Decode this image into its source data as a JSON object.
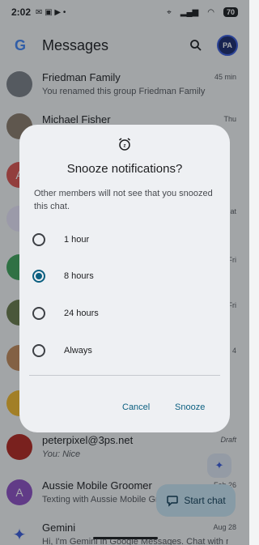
{
  "status_bar": {
    "time": "2:02",
    "battery": "70"
  },
  "app_bar": {
    "logo_letter": "G",
    "title": "Messages",
    "avatar_initials": "PA"
  },
  "conversations": [
    {
      "name": "Friedman Family",
      "snippet": "You renamed this group Friedman Family",
      "time": "45 min",
      "avatar_color": "#7b7f86",
      "avatar_text": ""
    },
    {
      "name": "Michael Fisher",
      "snippet": "",
      "time": "Thu",
      "avatar_color": "#8a7a6a",
      "avatar_text": ""
    },
    {
      "name": "",
      "snippet": "",
      "time": "",
      "avatar_color": "#d9534f",
      "avatar_text": "A"
    },
    {
      "name": "",
      "snippet": "",
      "time": "Sat",
      "avatar_color": "#e8e3f7",
      "avatar_text": ""
    },
    {
      "name": "",
      "snippet": "",
      "time": "Fri",
      "avatar_color": "#3fa35a",
      "avatar_text": ""
    },
    {
      "name": "",
      "snippet": "",
      "time": "Fri",
      "avatar_color": "#6a7a4a",
      "avatar_text": ""
    },
    {
      "name": "",
      "snippet": "",
      "time": "4",
      "avatar_color": "#c28a5a",
      "avatar_text": ""
    },
    {
      "name": "",
      "snippet": "",
      "time": "",
      "avatar_color": "#f2b92c",
      "avatar_text": ""
    },
    {
      "name": "peterpixel@3ps.net",
      "snippet": "You: Nice",
      "time": "Draft",
      "avatar_color": "#b3261e",
      "avatar_text": ""
    },
    {
      "name": "Aussie Mobile Groomer",
      "snippet": "Texting with Aussie Mobile Groomer",
      "time": "Feb 26",
      "avatar_color": "#8e4fc2",
      "avatar_text": "A"
    },
    {
      "name": "Gemini",
      "snippet": "Hi, I'm Gemini in Google Messages. Chat with me",
      "time": "Aug 28",
      "avatar_color": "#f3f4f5",
      "avatar_text": ""
    }
  ],
  "fab": {
    "start_chat_label": "Start chat"
  },
  "dialog": {
    "title": "Snooze notifications?",
    "description": "Other members will not see that you snoozed this chat.",
    "options": [
      {
        "label": "1 hour",
        "checked": false
      },
      {
        "label": "8 hours",
        "checked": true
      },
      {
        "label": "24 hours",
        "checked": false
      },
      {
        "label": "Always",
        "checked": false
      }
    ],
    "cancel_label": "Cancel",
    "confirm_label": "Snooze"
  }
}
